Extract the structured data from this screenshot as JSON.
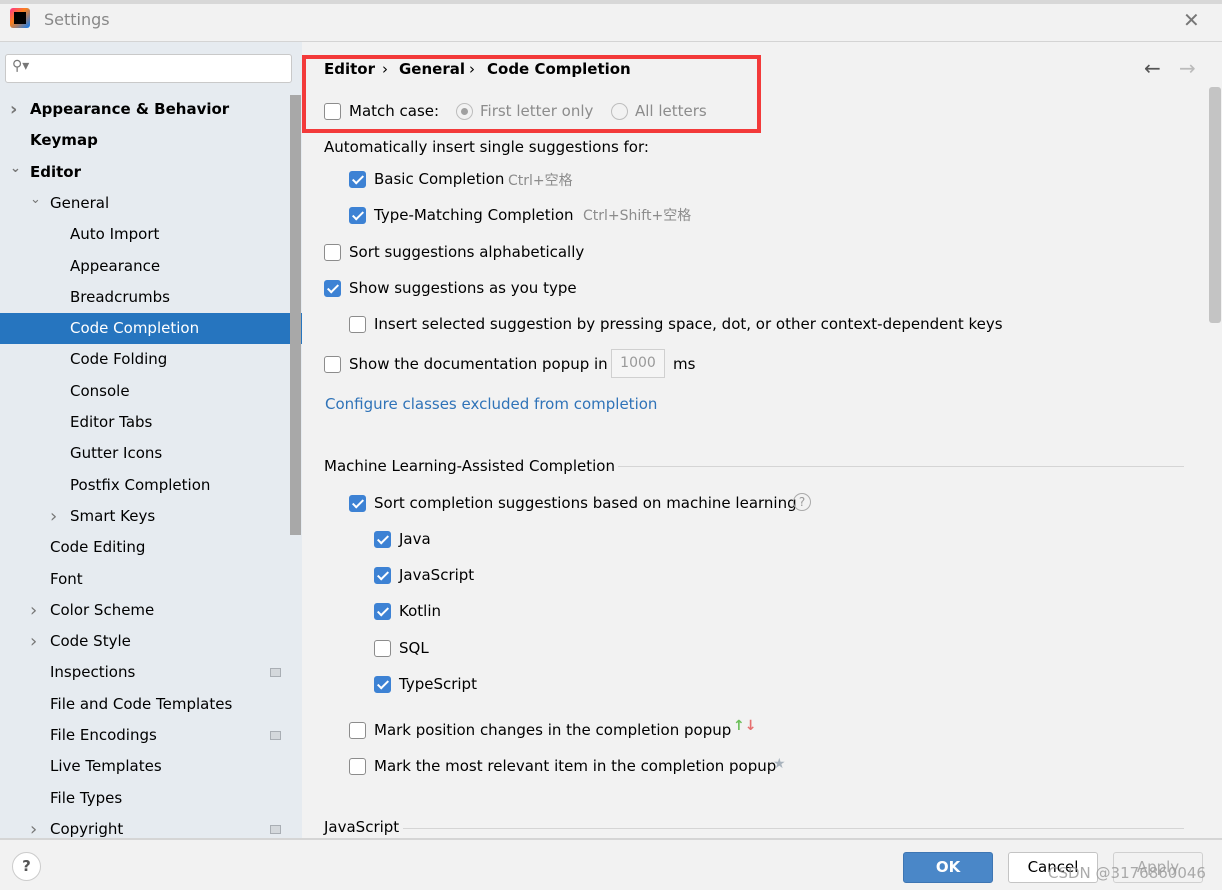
{
  "window": {
    "title": "Settings"
  },
  "search": {
    "placeholder": ""
  },
  "sidebar": {
    "items": [
      {
        "label": "Appearance & Behavior",
        "level": 0,
        "chevron": "right",
        "bold": true
      },
      {
        "label": "Keymap",
        "level": 0,
        "bold": true
      },
      {
        "label": "Editor",
        "level": 0,
        "chevron": "down",
        "bold": true
      },
      {
        "label": "General",
        "level": 1,
        "chevron": "down"
      },
      {
        "label": "Auto Import",
        "level": 2
      },
      {
        "label": "Appearance",
        "level": 2
      },
      {
        "label": "Breadcrumbs",
        "level": 2
      },
      {
        "label": "Code Completion",
        "level": 2,
        "selected": true
      },
      {
        "label": "Code Folding",
        "level": 2
      },
      {
        "label": "Console",
        "level": 2
      },
      {
        "label": "Editor Tabs",
        "level": 2
      },
      {
        "label": "Gutter Icons",
        "level": 2
      },
      {
        "label": "Postfix Completion",
        "level": 2
      },
      {
        "label": "Smart Keys",
        "level": 2,
        "chevron": "right"
      },
      {
        "label": "Code Editing",
        "level": 1
      },
      {
        "label": "Font",
        "level": 1
      },
      {
        "label": "Color Scheme",
        "level": 1,
        "chevron": "right"
      },
      {
        "label": "Code Style",
        "level": 1,
        "chevron": "right"
      },
      {
        "label": "Inspections",
        "level": 1,
        "project_icon": true
      },
      {
        "label": "File and Code Templates",
        "level": 1
      },
      {
        "label": "File Encodings",
        "level": 1,
        "project_icon": true
      },
      {
        "label": "Live Templates",
        "level": 1
      },
      {
        "label": "File Types",
        "level": 1
      },
      {
        "label": "Copyright",
        "level": 1,
        "chevron": "right",
        "project_icon": true
      }
    ]
  },
  "breadcrumb": [
    "Editor",
    "General",
    "Code Completion"
  ],
  "content": {
    "match_case": {
      "label": "Match case:",
      "checked": false,
      "options": [
        "First letter only",
        "All letters"
      ],
      "selected": "First letter only"
    },
    "auto_insert_header": "Automatically insert single suggestions for:",
    "basic_completion": {
      "label": "Basic Completion",
      "shortcut": "Ctrl+空格",
      "checked": true
    },
    "type_matching": {
      "label": "Type-Matching Completion",
      "shortcut": "Ctrl+Shift+空格",
      "checked": true
    },
    "sort_alpha": {
      "label": "Sort suggestions alphabetically",
      "checked": false
    },
    "show_as_type": {
      "label": "Show suggestions as you type",
      "checked": true
    },
    "insert_selected": {
      "label": "Insert selected suggestion by pressing space, dot, or other context-dependent keys",
      "checked": false
    },
    "doc_popup": {
      "label": "Show the documentation popup in",
      "value": "1000",
      "unit": "ms",
      "checked": false
    },
    "configure_link": "Configure classes excluded from completion",
    "ml_section": "Machine Learning-Assisted Completion",
    "ml_sort": {
      "label": "Sort completion suggestions based on machine learning",
      "checked": true
    },
    "ml_languages": [
      {
        "label": "Java",
        "checked": true
      },
      {
        "label": "JavaScript",
        "checked": true
      },
      {
        "label": "Kotlin",
        "checked": true
      },
      {
        "label": "SQL",
        "checked": false
      },
      {
        "label": "TypeScript",
        "checked": true
      }
    ],
    "mark_position": {
      "label": "Mark position changes in the completion popup",
      "checked": false
    },
    "mark_relevant": {
      "label": "Mark the most relevant item in the completion popup",
      "checked": false
    },
    "js_section": "JavaScript"
  },
  "buttons": {
    "ok": "OK",
    "cancel": "Cancel",
    "apply": "Apply",
    "help": "?"
  },
  "watermark": "CSDN @3176860046",
  "colors": {
    "accent": "#2675bf",
    "highlight_box": "#f33a3a"
  }
}
